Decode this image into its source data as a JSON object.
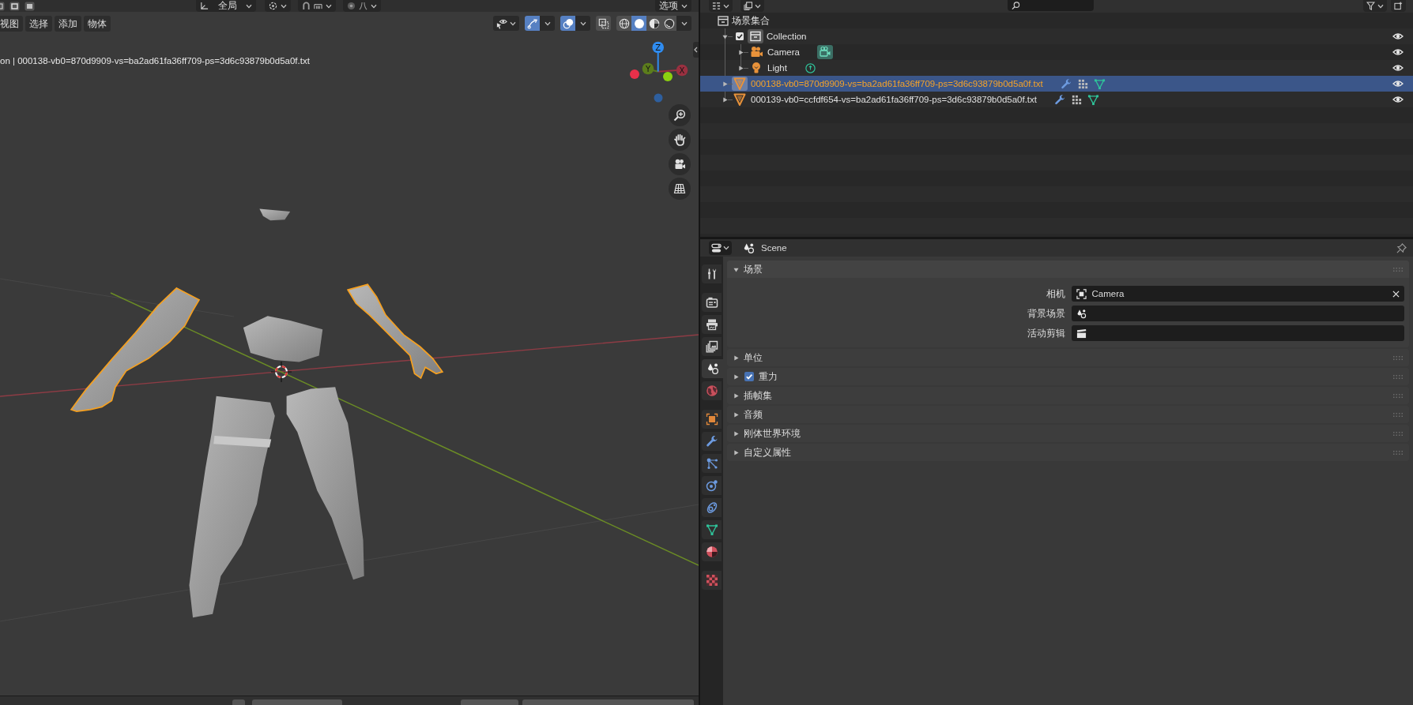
{
  "viewport_header": {
    "orientation": "全局",
    "options": "选项"
  },
  "viewport": {
    "menus": [
      "视图",
      "选择",
      "添加",
      "物体"
    ],
    "toggles": {
      "gizmos": {
        "on": true
      },
      "overlays": {
        "on": true
      },
      "xray": {
        "on": false
      }
    },
    "shading": [
      {
        "kind": "wireframe",
        "selected": false
      },
      {
        "kind": "solid",
        "selected": true
      },
      {
        "kind": "material",
        "selected": false
      },
      {
        "kind": "rendered",
        "selected": false
      }
    ],
    "info_text": "on | 000138-vb0=870d9909-vs=ba2ad61fa36ff709-ps=3d6c93879b0d5a0f.txt",
    "gizmo_axes": [
      "Z",
      "Y",
      "X"
    ]
  },
  "outliner": {
    "root": {
      "label": "场景集合",
      "children": [
        {
          "label": "Collection",
          "kind": "collection",
          "selected": false,
          "expanded": true,
          "checked": true,
          "visible": true,
          "children": [
            {
              "label": "Camera",
              "kind": "camera",
              "selected": false,
              "expanded": false,
              "visible": true
            },
            {
              "label": "Light",
              "kind": "light",
              "selected": false,
              "expanded": false,
              "visible": true
            }
          ]
        },
        {
          "label": "000138-vb0=870d9909-vs=ba2ad61fa36ff709-ps=3d6c93879b0d5a0f.txt",
          "kind": "mesh",
          "selected": true,
          "expanded": false,
          "visible": true
        },
        {
          "label": "000139-vb0=ccfdf654-vs=ba2ad61fa36ff709-ps=3d6c93879b0d5a0f.txt",
          "kind": "mesh",
          "selected": false,
          "expanded": false,
          "visible": true
        }
      ]
    }
  },
  "properties": {
    "title": "Scene",
    "tabs": [
      {
        "kind": "tool",
        "selected": false
      },
      {
        "kind": "render",
        "selected": false
      },
      {
        "kind": "output",
        "selected": false
      },
      {
        "kind": "view_layer",
        "selected": false
      },
      {
        "kind": "scene",
        "selected": true
      },
      {
        "kind": "world",
        "selected": false
      },
      {
        "kind": "object",
        "selected": false
      },
      {
        "kind": "modifiers",
        "selected": false
      },
      {
        "kind": "particles",
        "selected": false
      },
      {
        "kind": "physics",
        "selected": false
      },
      {
        "kind": "constraints",
        "selected": false
      },
      {
        "kind": "data",
        "selected": false
      },
      {
        "kind": "material",
        "selected": false
      },
      {
        "kind": "texture",
        "selected": false
      }
    ],
    "panels": [
      {
        "title": "场景",
        "kind": "plain",
        "expanded": true,
        "fields": [
          {
            "label": "相机",
            "kind": "camera",
            "value": "Camera"
          },
          {
            "label": "背景场景",
            "kind": "scene"
          },
          {
            "label": "活动剪辑",
            "kind": "clip"
          }
        ]
      },
      {
        "title": "单位",
        "kind": "plain",
        "expanded": false
      },
      {
        "title": "重力",
        "kind": "toggle",
        "expanded": false,
        "checked": true
      },
      {
        "title": "插帧集",
        "kind": "plain",
        "expanded": false
      },
      {
        "title": "音频",
        "kind": "plain",
        "expanded": false
      },
      {
        "title": "刚体世界环境",
        "kind": "plain",
        "expanded": false
      },
      {
        "title": "自定义属性",
        "kind": "plain",
        "expanded": false
      }
    ]
  }
}
